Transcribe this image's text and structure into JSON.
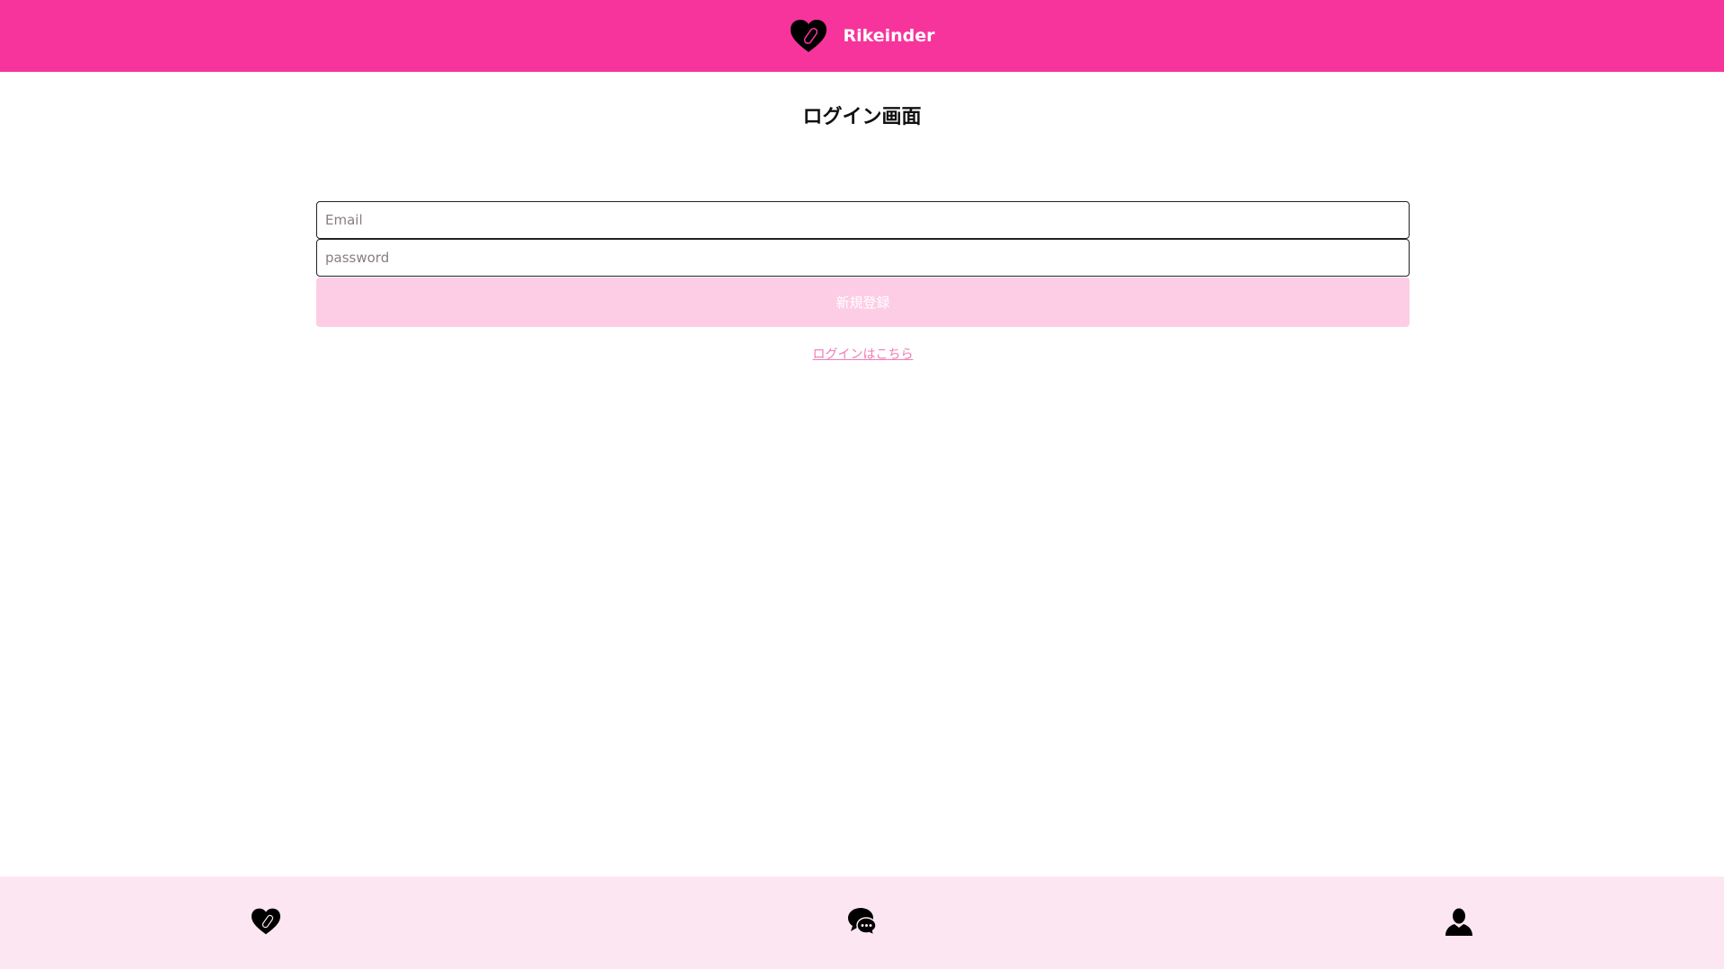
{
  "header": {
    "brand": "Rikeinder",
    "logo_icon": "heart-pill-icon",
    "background_color": "#f7349c"
  },
  "page": {
    "title": "ログイン画面"
  },
  "form": {
    "email_placeholder": "Email",
    "email_value": "",
    "password_placeholder": "password",
    "password_value": "",
    "submit_label": "新規登録",
    "submit_color": "#fccde5",
    "login_link": "ログインはこちら"
  },
  "bottom_nav": {
    "background_color": "#fce6f1",
    "items": [
      {
        "icon": "heart-pill-icon"
      },
      {
        "icon": "chat-bubbles-icon"
      },
      {
        "icon": "user-icon"
      }
    ]
  }
}
